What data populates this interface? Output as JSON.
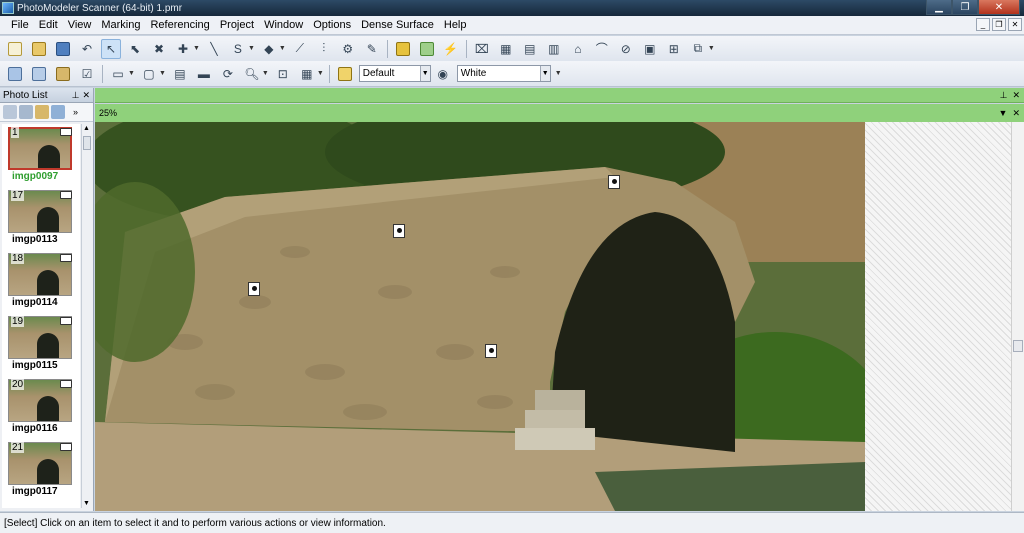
{
  "window": {
    "title": "PhotoModeler Scanner (64-bit) 1.pmr"
  },
  "menu": {
    "items": [
      "File",
      "Edit",
      "View",
      "Marking",
      "Referencing",
      "Project",
      "Window",
      "Options",
      "Dense Surface",
      "Help"
    ]
  },
  "toolbar2": {
    "style_value": "Default",
    "color_value": "White"
  },
  "photo_list": {
    "title": "Photo List",
    "items": [
      {
        "num": "1",
        "label": "imgp0097"
      },
      {
        "num": "17",
        "label": "imgp0113"
      },
      {
        "num": "18",
        "label": "imgp0114"
      },
      {
        "num": "19",
        "label": "imgp0115"
      },
      {
        "num": "20",
        "label": "imgp0116"
      },
      {
        "num": "21",
        "label": "imgp0117"
      }
    ]
  },
  "viewer": {
    "zoom": "25%"
  },
  "status": {
    "text": "[Select] Click on an item to select it and to perform various actions or view information."
  },
  "colors": {
    "accent": "#8fd17b",
    "selected_label": "#2e9e2e",
    "selection_border": "#c0392b"
  },
  "icons": [
    "new-project-icon",
    "open-icon",
    "save-icon",
    "undo-icon",
    "select-icon",
    "mark-points-icon",
    "zoom-icon"
  ]
}
